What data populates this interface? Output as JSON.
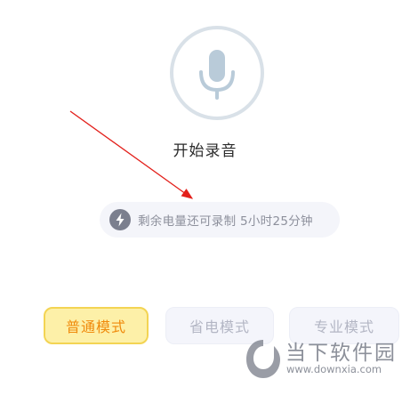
{
  "recorder": {
    "start_label": "开始录音",
    "mic_icon": "microphone-icon"
  },
  "battery": {
    "icon": "lightning-bolt-icon",
    "text": "剩余电量还可录制 5小时25分钟"
  },
  "modes": {
    "normal": "普通模式",
    "power_save": "省电模式",
    "professional": "专业模式",
    "selected": "普通模式"
  },
  "watermark": {
    "name": "当下软件园",
    "url": "www.downxia.com"
  },
  "colors": {
    "ring": "#d9e1e8",
    "mic": "#b9cbd9",
    "active_bg": "#fdf0a8",
    "active_border": "#f3d453",
    "active_text": "#f08a0c",
    "idle_text": "#b3b6c4",
    "annotation_arrow": "#e3201b"
  }
}
